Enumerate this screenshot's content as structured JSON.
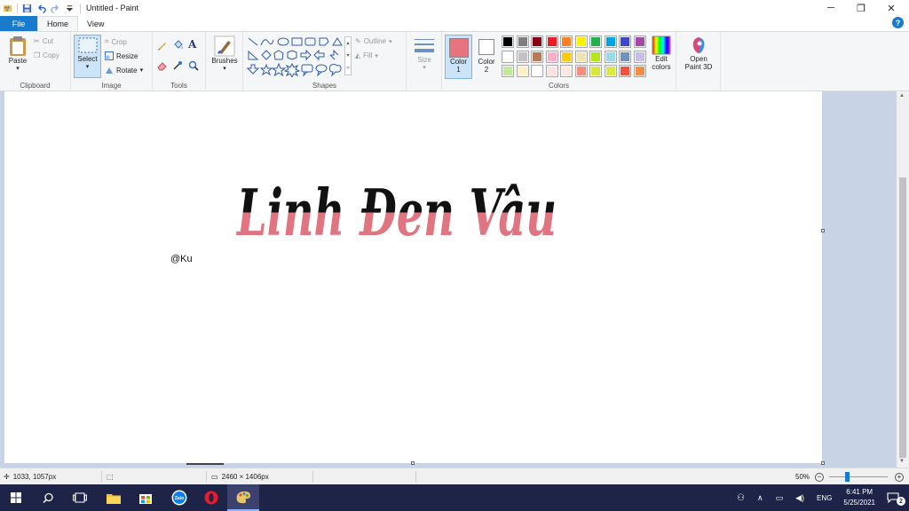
{
  "window": {
    "title": "Untitled - Paint",
    "controls": {
      "minimize": "─",
      "restore": "❐",
      "close": "✕"
    }
  },
  "tabs": [
    {
      "label": "File"
    },
    {
      "label": "Home"
    },
    {
      "label": "View"
    }
  ],
  "ribbon": {
    "clipboard": {
      "label": "Clipboard",
      "paste": "Paste",
      "cut": "Cut",
      "copy": "Copy"
    },
    "image": {
      "label": "Image",
      "select": "Select",
      "crop": "Crop",
      "resize": "Resize",
      "rotate": "Rotate"
    },
    "tools": {
      "label": "Tools"
    },
    "brushes": {
      "label": "Brushes"
    },
    "shapes": {
      "label": "Shapes",
      "outline": "Outline",
      "fill": "Fill"
    },
    "size": {
      "label": "Size"
    },
    "colors": {
      "label": "Colors",
      "color1_label": "Color",
      "color1_num": "1",
      "color2_label": "Color",
      "color2_num": "2",
      "color1": "#e8737f",
      "color2": "#ffffff",
      "edit_colors": "Edit colors",
      "edit_label1": "Edit",
      "edit_label2": "colors",
      "palette": [
        "#000000",
        "#7f7f7f",
        "#880015",
        "#ed1c24",
        "#ff7f27",
        "#fff200",
        "#22b14c",
        "#00a2e8",
        "#3f48cc",
        "#a349a4",
        "#ffffff",
        "#c3c3c3",
        "#b97a57",
        "#ffaec9",
        "#ffc90e",
        "#efe4b0",
        "#b5e61d",
        "#99d9ea",
        "#7092be",
        "#c8bfe7",
        "#c4e89a",
        "#fff0c4",
        "#ffffff",
        "#ffe1e1",
        "#ffe8e0",
        "#f58e7a",
        "#d5e83b",
        "#d9ea43",
        "#f0523f",
        "#f58e4a",
        "#1a7a3a"
      ]
    },
    "paint3d": {
      "label1": "Open",
      "label2": "Paint 3D"
    }
  },
  "canvas": {
    "artwork_text": "Linh Đen Vâu",
    "signature": "@Ku"
  },
  "statusbar": {
    "cursor": "1033, 1057px",
    "image_size": "2460 × 1406px",
    "zoom": "50%",
    "zoom_level": 0.5
  },
  "taskbar": {
    "tray_lang": "ENG",
    "time": "6:41 PM",
    "date": "5/25/2021",
    "notif_count": "2"
  }
}
